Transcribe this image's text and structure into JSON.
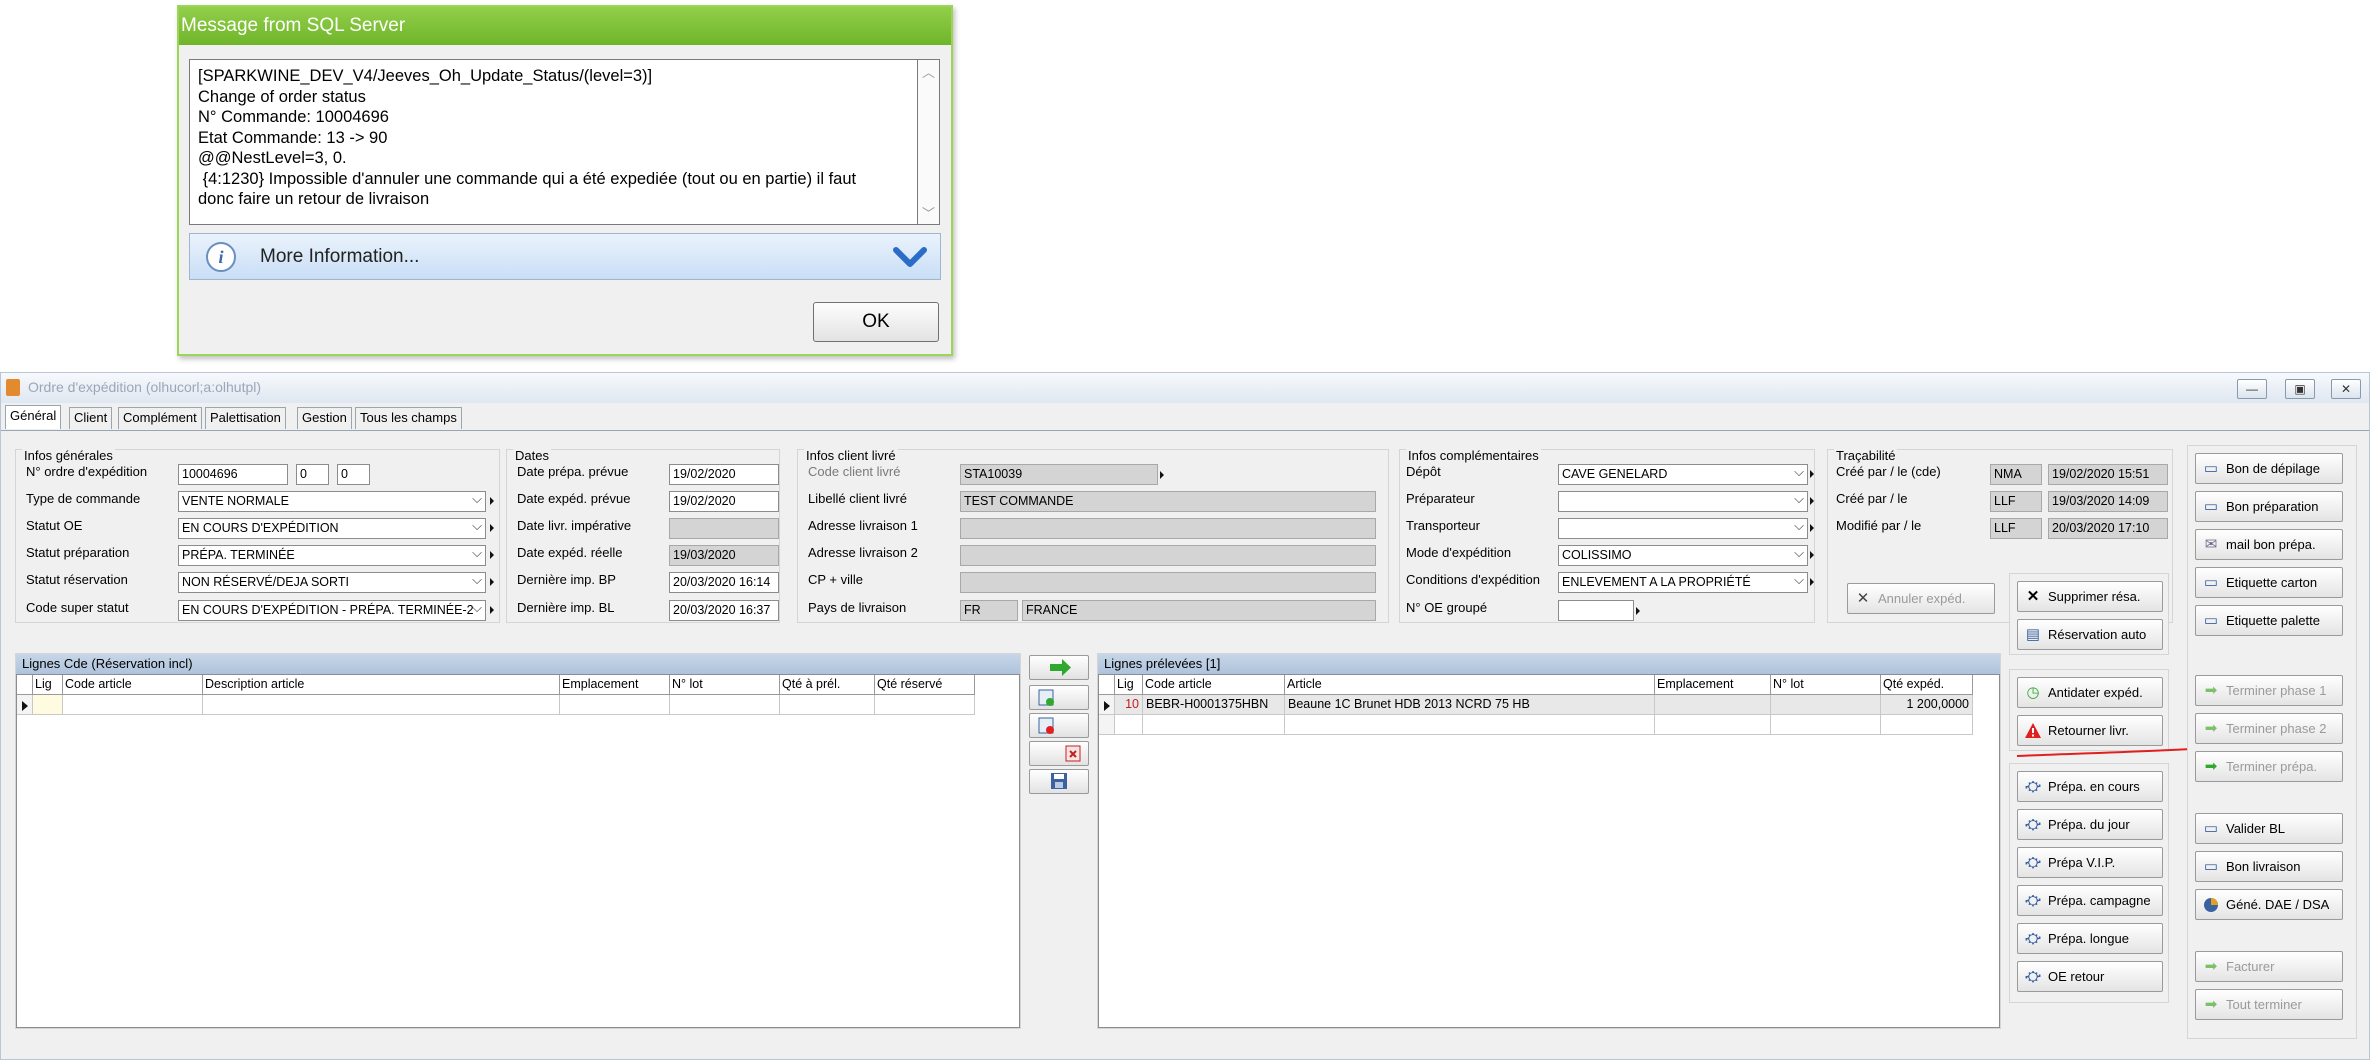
{
  "dialog": {
    "title": "Message from SQL Server",
    "message": "[SPARKWINE_DEV_V4/Jeeves_Oh_Update_Status/(level=3)]\nChange of order status\nN° Commande: 10004696\nEtat Commande: 13 -> 90\n@@NestLevel=3, 0.\n {4:1230} Impossible d'annuler une commande qui a été expediée (tout ou en partie) il faut\ndonc faire un retour de livraison",
    "more_info": "More Information...",
    "ok": "OK"
  },
  "window": {
    "title": "Ordre d'expédition (olhucorl;a:olhutpl)",
    "tabs": [
      "Général",
      "Client",
      "Complément",
      "Palettisation",
      "Gestion",
      "Tous les champs"
    ]
  },
  "infos_generales": {
    "title": "Infos générales",
    "ordre_label": "N° ordre d'expédition",
    "ordre": "10004696",
    "ordre_sub1": "0",
    "ordre_sub2": "0",
    "type_label": "Type de commande",
    "type": "VENTE NORMALE",
    "statut_oe_label": "Statut OE",
    "statut_oe": "EN COURS D'EXPÉDITION",
    "statut_prep_label": "Statut préparation",
    "statut_prep": "PRÉPA. TERMINÉE",
    "statut_resa_label": "Statut réservation",
    "statut_resa": "NON RÉSERVÉ/DEJA SORTI",
    "code_super_label": "Code super statut",
    "code_super": "EN COURS D'EXPÉDITION - PRÉPA. TERMINÉE-2"
  },
  "dates": {
    "title": "Dates",
    "prepa_label": "Date prépa. prévue",
    "prepa": "19/02/2020",
    "exped_label": "Date expéd. prévue",
    "exped": "19/02/2020",
    "livr_label": "Date livr. impérative",
    "livr": "",
    "reelle_label": "Date expéd. réelle",
    "reelle": "19/03/2020",
    "bp_label": "Dernière imp. BP",
    "bp": "20/03/2020 16:14",
    "bl_label": "Dernière imp. BL",
    "bl": "20/03/2020 16:37"
  },
  "client_livre": {
    "title": "Infos client livré",
    "code_label": "Code client livré",
    "code": "STA10039",
    "libelle_label": "Libellé client livré",
    "libelle": "TEST COMMANDE",
    "adr1_label": "Adresse livraison 1",
    "adr2_label": "Adresse livraison 2",
    "cp_label": "CP + ville",
    "pays_label": "Pays de livraison",
    "pays_code": "FR",
    "pays": "FRANCE"
  },
  "complementaires": {
    "title": "Infos complémentaires",
    "depot_label": "Dépôt",
    "depot": "CAVE GENELARD",
    "prep_label": "Préparateur",
    "prep": "",
    "transp_label": "Transporteur",
    "transp": "",
    "mode_label": "Mode d'expédition",
    "mode": "COLISSIMO",
    "cond_label": "Conditions d'expédition",
    "cond": "ENLEVEMENT A LA PROPRIÉTÉ",
    "oe_label": "N° OE groupé",
    "oe": ""
  },
  "tracabilite": {
    "title": "Traçabilité",
    "rows": [
      {
        "label": "Créé par / le (cde)",
        "user": "NMA",
        "date": "19/02/2020 15:51"
      },
      {
        "label": "Créé par / le",
        "user": "LLF",
        "date": "19/03/2020 14:09"
      },
      {
        "label": "Modifié par / le",
        "user": "LLF",
        "date": "20/03/2020 17:10"
      }
    ]
  },
  "lignes_cde": {
    "title": "Lignes Cde (Réservation incl)",
    "columns": [
      "Lig",
      "Code article",
      "Description article",
      "Emplacement",
      "N° lot",
      "Qté à prél.",
      "Qté réservé"
    ]
  },
  "lignes_prelevees": {
    "title": "Lignes prélevées [1]",
    "columns": [
      "Lig",
      "Code article",
      "Article",
      "Emplacement",
      "N° lot",
      "Qté expéd."
    ],
    "rows": [
      {
        "lig": "10",
        "code": "BEBR-H0001375HBN",
        "article": "Beaune 1C Brunet HDB 2013 NCRD 75 HB",
        "emplacement": "",
        "lot": "",
        "qte": "1 200,0000"
      }
    ]
  },
  "buttons": {
    "annuler_exped": "Annuler expéd.",
    "supprimer_resa": "Supprimer résa.",
    "reservation_auto": "Réservation auto",
    "antidater": "Antidater expéd.",
    "retourner": "Retourner livr.",
    "prepa_en_cours": "Prépa. en cours",
    "prepa_du_jour": "Prépa. du jour",
    "prepa_vip": "Prépa V.I.P.",
    "prepa_campagne": "Prépa. campagne",
    "prepa_longue": "Prépa. longue",
    "oe_retour": "OE retour",
    "bon_depilage": "Bon de dépilage",
    "bon_preparation": "Bon préparation",
    "mail_bon_prepa": "mail bon prépa.",
    "etiquette_carton": "Etiquette carton",
    "etiquette_palette": "Etiquette palette",
    "terminer_phase1": "Terminer phase 1",
    "terminer_phase2": "Terminer phase 2",
    "terminer_prepa": "Terminer prépa.",
    "valider_bl": "Valider BL",
    "bon_livraison": "Bon livraison",
    "gene_dae": "Géné. DAE / DSA",
    "facturer": "Facturer",
    "tout_terminer": "Tout terminer"
  },
  "colors": {
    "dialog_title_bg": "#7cc03a",
    "grid_header_bg": "#b8cbe2",
    "warning_red": "#e02020",
    "arrow_green": "#2ea82e"
  }
}
